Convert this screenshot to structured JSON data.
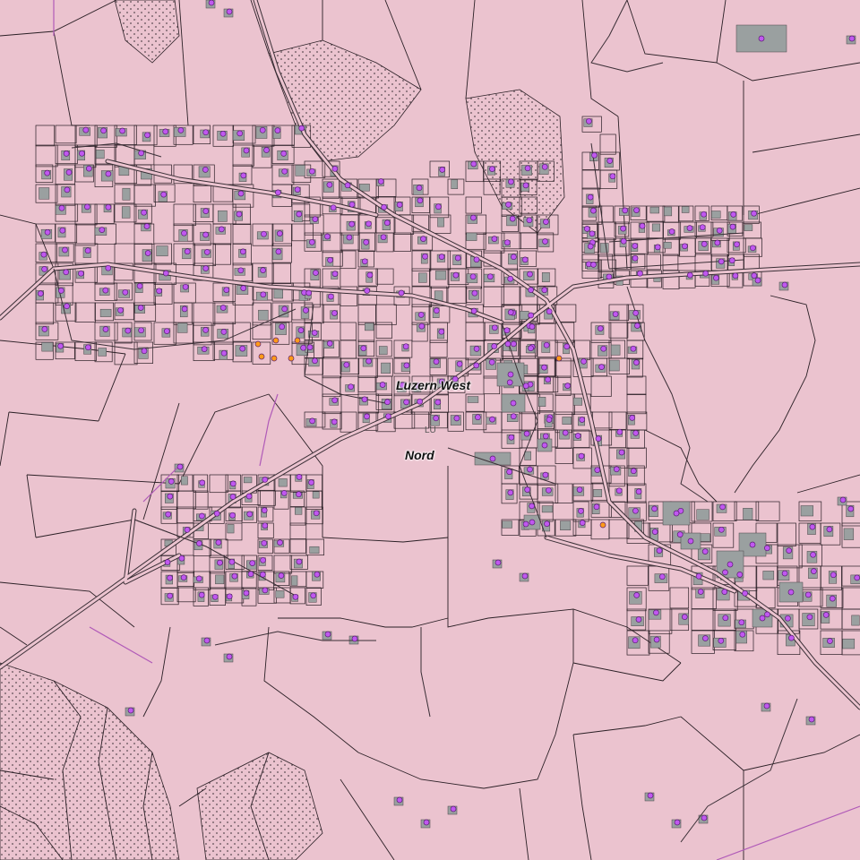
{
  "map": {
    "labels": {
      "main": "Luzern West",
      "sub": "Nord",
      "canton": "LU"
    },
    "colors": {
      "background": "#ebc3cf",
      "parcel_line": "#2a1f25",
      "building": "#9aa0a0",
      "road_casing": "#3a2f36",
      "road_fill": "#ebc3cf",
      "address_point": "#c058f0",
      "address_point_highlight": "#ff9a1a",
      "boundary": "#b05ab8",
      "forest_dots": "#5a4a52"
    },
    "legend_semantics": {
      "address_point": "purple circle",
      "address_point_highlight": "orange circle",
      "building": "grey polygon",
      "forest": "dotted area"
    }
  }
}
